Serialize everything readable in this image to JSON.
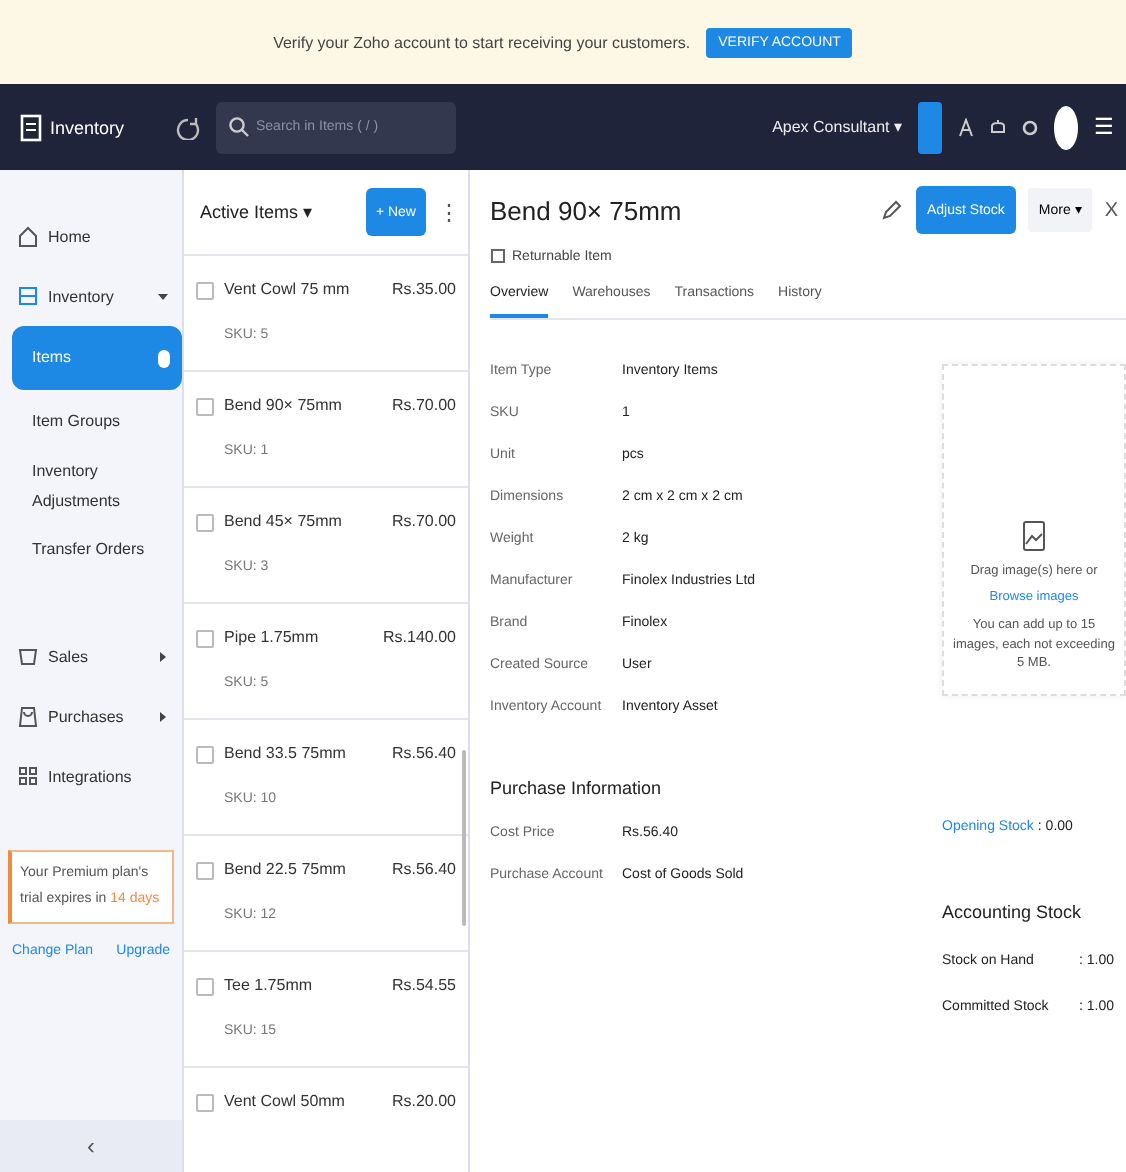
{
  "banner": {
    "message": "Verify your Zoho account to start receiving your customers.",
    "button": "VERIFY ACCOUNT"
  },
  "topbar": {
    "app_name": "Inventory",
    "search": {
      "placeholder": "Search in Items ( / )"
    },
    "organization": "Apex Consultant ▾",
    "menu_glyph": "☰"
  },
  "sidebar": {
    "items": [
      {
        "label": "Home",
        "selected": false
      },
      {
        "label": "Inventory",
        "selected": false,
        "expanded": true,
        "children": [
          {
            "label": "Items",
            "selected": true
          },
          {
            "label": "Item Groups",
            "selected": false
          },
          {
            "label": "Inventory Adjustments",
            "selected": false
          },
          {
            "label": "Transfer Orders",
            "selected": false
          }
        ]
      },
      {
        "label": "Sales",
        "selected": false,
        "expanded": false
      },
      {
        "label": "Purchases",
        "selected": false,
        "expanded": false
      },
      {
        "label": "Integrations",
        "selected": false
      }
    ],
    "promo": {
      "text": "Your Premium plan's trial expires in",
      "highlight": "14 days"
    },
    "links": [
      "Change Plan",
      "Upgrade"
    ],
    "collapse": "‹"
  },
  "item_list": {
    "filter": "Active Items ▾",
    "new_button": "+ New",
    "more": "⋮",
    "rows": [
      {
        "name": "Vent Cowl 75 mm",
        "price": "Rs.35.00",
        "sku": "SKU: 5",
        "checked": false
      },
      {
        "name": "Bend 90× 75mm",
        "price": "Rs.70.00",
        "sku": "SKU: 1",
        "checked": false
      },
      {
        "name": "Bend 45× 75mm",
        "price": "Rs.70.00",
        "sku": "SKU: 3",
        "checked": false
      },
      {
        "name": "Pipe 1.75mm",
        "price": "Rs.140.00",
        "sku": "SKU: 5",
        "checked": false
      },
      {
        "name": "Bend 33.5 75mm",
        "price": "Rs.56.40",
        "sku": "SKU: 10",
        "checked": false
      },
      {
        "name": "Bend 22.5 75mm",
        "price": "Rs.56.40",
        "sku": "SKU: 12",
        "checked": false
      },
      {
        "name": "Tee 1.75mm",
        "price": "Rs.54.55",
        "sku": "SKU: 15",
        "checked": false
      },
      {
        "name": "Vent Cowl 50mm",
        "price": "Rs.20.00",
        "sku": "",
        "checked": false
      }
    ]
  },
  "detail": {
    "title": "Bend 90× 75mm",
    "badge": "Returnable Item",
    "adjust_button": "Adjust Stock",
    "more_button": "More ▾",
    "close": "X",
    "tabs": [
      {
        "label": "Overview",
        "selected": true
      },
      {
        "label": "Warehouses",
        "selected": false
      },
      {
        "label": "Transactions",
        "selected": false
      },
      {
        "label": "History",
        "selected": false
      }
    ],
    "fields": [
      {
        "label": "Item Type",
        "value": "Inventory Items"
      },
      {
        "label": "SKU",
        "value": "1"
      },
      {
        "label": "Unit",
        "value": "pcs"
      },
      {
        "label": "Dimensions",
        "value": "2 cm x 2 cm x 2 cm"
      },
      {
        "label": "Weight",
        "value": "2 kg"
      },
      {
        "label": "Manufacturer",
        "value": "Finolex Industries Ltd"
      },
      {
        "label": "Brand",
        "value": "Finolex"
      },
      {
        "label": "Created Source",
        "value": "User"
      },
      {
        "label": "Inventory Account",
        "value": "Inventory Asset"
      }
    ],
    "purchase": {
      "heading": "Purchase Information",
      "fields": [
        {
          "label": "Cost Price",
          "value": "Rs.56.40"
        },
        {
          "label": "Purchase Account",
          "value": "Cost of Goods Sold"
        }
      ]
    },
    "image_box": {
      "hint": "Drag image(s) here or",
      "link": "Browse images",
      "note": "You can add up to 15 images, each not exceeding 5 MB."
    },
    "opening_stock": {
      "label": "Opening Stock",
      "value": ": 0.00"
    },
    "accounting_stock": {
      "heading": "Accounting Stock",
      "rows": [
        {
          "label": "Stock on Hand",
          "value": ": 1.00"
        },
        {
          "label": "Committed Stock",
          "value": ": 1.00"
        }
      ]
    }
  }
}
